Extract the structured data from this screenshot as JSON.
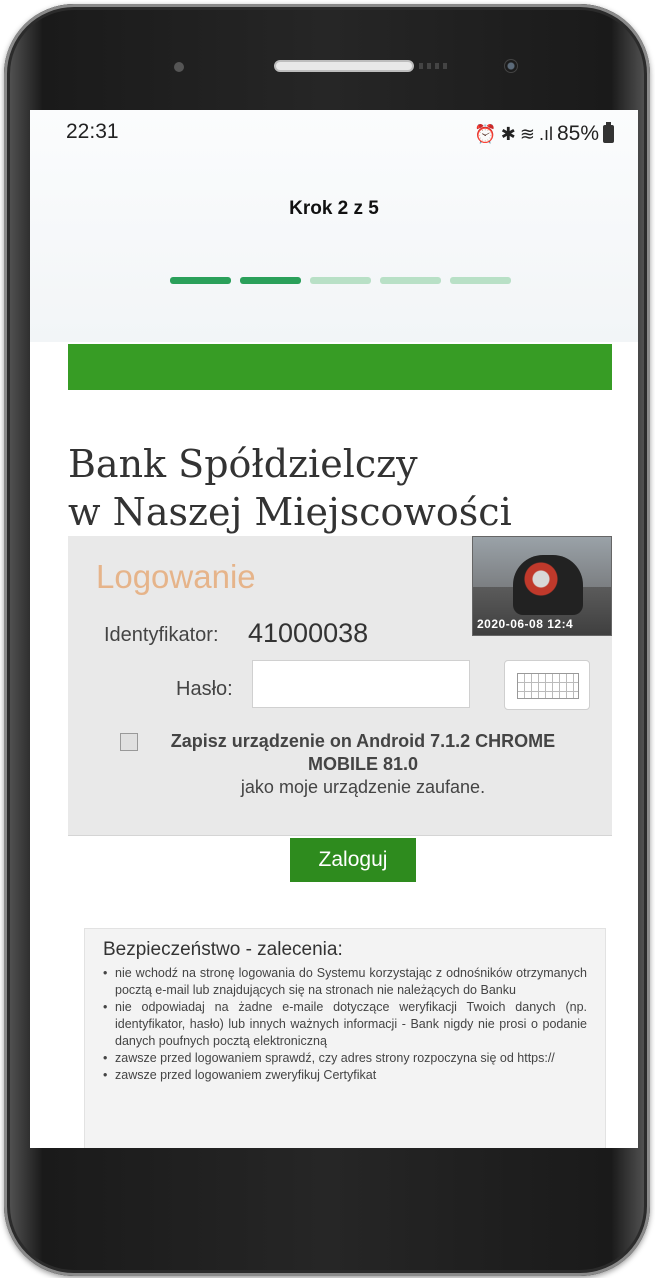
{
  "status_bar": {
    "time": "22:31",
    "icons": [
      "alarm-icon",
      "bluetooth-icon",
      "wifi-icon",
      "lte-icon",
      "signal-icon"
    ],
    "battery": "85%"
  },
  "header": {
    "step_label": "Krok 2 z 5",
    "steps_total": 5,
    "steps_done": 2,
    "color_done": "#2aa05a",
    "color_todo": "#b8e0c6"
  },
  "banner": {
    "color": "#379c25"
  },
  "bank": {
    "name_line1": "Bank Spółdzielczy",
    "name_line2": "w Naszej Miejscowości"
  },
  "thumbnail": {
    "stamp": "2020-06-08 12:4"
  },
  "login": {
    "title": "Logowanie",
    "id_label": "Identyfikator:",
    "id_value": "41000038",
    "password_label": "Hasło:",
    "password_value": "",
    "remember_bold": "Zapisz urządzenie on Android 7.1.2 CHROME MOBILE 81.0",
    "remember_rest": "jako moje urządzenie zaufane.",
    "remember_checked": false,
    "submit_label": "Zaloguj",
    "submit_color": "#2e8b1e"
  },
  "security": {
    "title": "Bezpieczeństwo - zalecenia:",
    "items": [
      "nie wchodź na stronę logowania do Systemu korzystając z odnośników otrzymanych pocztą e-mail lub znajdujących się na stronach nie należących do Banku",
      "nie odpowiadaj na żadne e-maile dotyczące weryfikacji Twoich danych (np. identyfikator, hasło) lub innych ważnych informacji - Bank nigdy nie prosi o podanie danych poufnych pocztą elektroniczną",
      "zawsze przed logowaniem sprawdź, czy adres strony rozpoczyna się od https://",
      "zawsze przed logowaniem zweryfikuj Certyfikat"
    ]
  }
}
